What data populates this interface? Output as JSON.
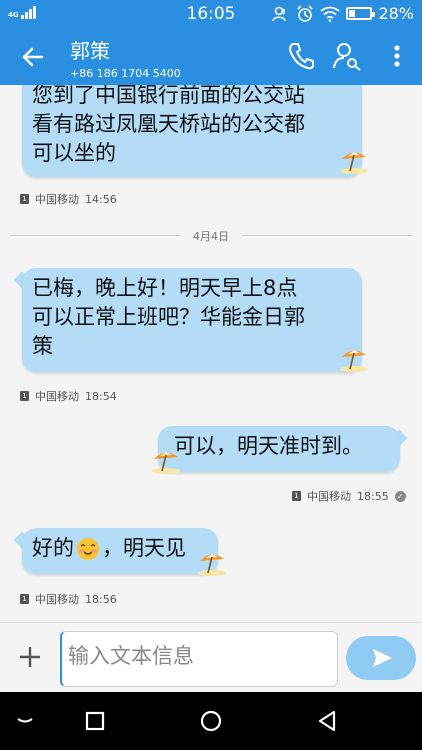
{
  "status_bar": {
    "network": "4G",
    "time": "16:05",
    "battery_percent": "28%",
    "battery_level": 0.28,
    "icons": [
      "signal-icon",
      "contacts-icon",
      "alarm-icon",
      "wifi-icon",
      "battery-icon"
    ]
  },
  "header": {
    "contact_name": "郭策",
    "contact_number": "+86 186 1704 5400",
    "icons": [
      "back-arrow-icon",
      "phone-icon",
      "contact-search-icon",
      "more-vertical-icon"
    ]
  },
  "messages": [
    {
      "direction": "incoming",
      "lines": [
        "您到了中国银行前面的公交站",
        "看有路过凤凰天桥站的公交都",
        "可以坐的"
      ],
      "sim": "1",
      "carrier": "中国移动",
      "time": "14:56"
    },
    {
      "direction": "incoming",
      "lines": [
        "已梅，晚上好！明天早上8点",
        "可以正常上班吧？华能金日郭",
        "策"
      ],
      "sim": "1",
      "carrier": "中国移动",
      "time": "18:54"
    },
    {
      "direction": "outgoing",
      "lines": [
        "可以，明天准时到。"
      ],
      "sim": "1",
      "carrier": "中国移动",
      "time": "18:55",
      "delivered": true
    },
    {
      "direction": "incoming",
      "text_before_emoji": "好的",
      "emoji": "smiling-face-emoji",
      "text_after_emoji": "，明天见",
      "sim": "1",
      "carrier": "中国移动",
      "time": "18:56"
    }
  ],
  "date_divider": "4月4日",
  "composer": {
    "placeholder": "输入文本信息",
    "icons": [
      "add-icon",
      "send-icon"
    ]
  },
  "nav_bar": {
    "icons": [
      "hide-keyboard-icon",
      "recents-icon",
      "home-icon",
      "back-icon"
    ]
  },
  "colors": {
    "accent": "#2a8fe0",
    "bubble": "#b5dcf7",
    "send_button": "#8fcbf3",
    "background": "#f4f4f4"
  }
}
